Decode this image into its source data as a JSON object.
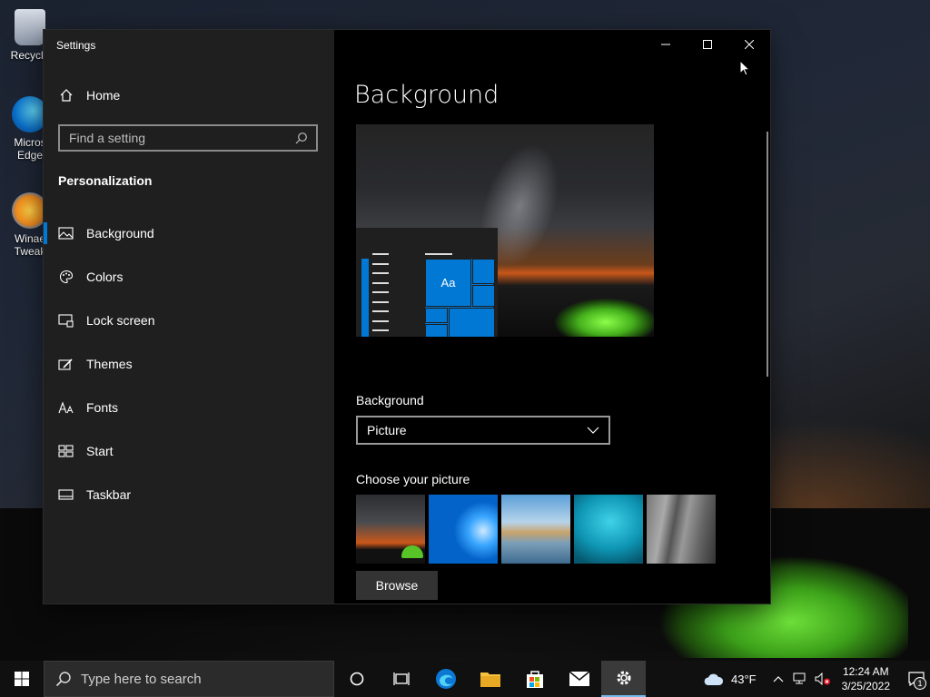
{
  "desktop": {
    "icons": [
      {
        "label": "Recycle",
        "icon": "recycle-bin-icon"
      },
      {
        "label": "Micros Edge",
        "icon": "edge-icon"
      },
      {
        "label": "Winae Tweak",
        "icon": "winaero-tweaker-icon"
      }
    ]
  },
  "window": {
    "title": "Settings",
    "controls": {
      "minimize": "minimize-icon",
      "maximize": "maximize-icon",
      "close": "close-icon"
    }
  },
  "sidebar": {
    "home_label": "Home",
    "search_placeholder": "Find a setting",
    "section_title": "Personalization",
    "items": [
      {
        "label": "Background",
        "icon": "picture-icon",
        "active": true
      },
      {
        "label": "Colors",
        "icon": "palette-icon",
        "active": false
      },
      {
        "label": "Lock screen",
        "icon": "lock-screen-icon",
        "active": false
      },
      {
        "label": "Themes",
        "icon": "themes-icon",
        "active": false
      },
      {
        "label": "Fonts",
        "icon": "fonts-icon",
        "active": false
      },
      {
        "label": "Start",
        "icon": "start-icon",
        "active": false
      },
      {
        "label": "Taskbar",
        "icon": "taskbar-icon",
        "active": false
      }
    ]
  },
  "main": {
    "page_title": "Background",
    "preview_tile_text": "Aa",
    "background_label": "Background",
    "background_value": "Picture",
    "choose_picture_label": "Choose your picture",
    "browse_label": "Browse"
  },
  "taskbar": {
    "search_placeholder": "Type here to search",
    "apps": [
      "cortana-icon",
      "task-view-icon",
      "edge-icon",
      "file-explorer-icon",
      "store-icon",
      "mail-icon",
      "settings-icon"
    ],
    "active_app": "settings-icon",
    "weather": "43°F",
    "time": "12:24 AM",
    "date": "3/25/2022",
    "notification_count": "1"
  },
  "colors": {
    "accent": "#0078d4",
    "sidebar_bg": "#1f1f1f",
    "main_bg": "#000000",
    "taskbar_bg": "#101010"
  }
}
